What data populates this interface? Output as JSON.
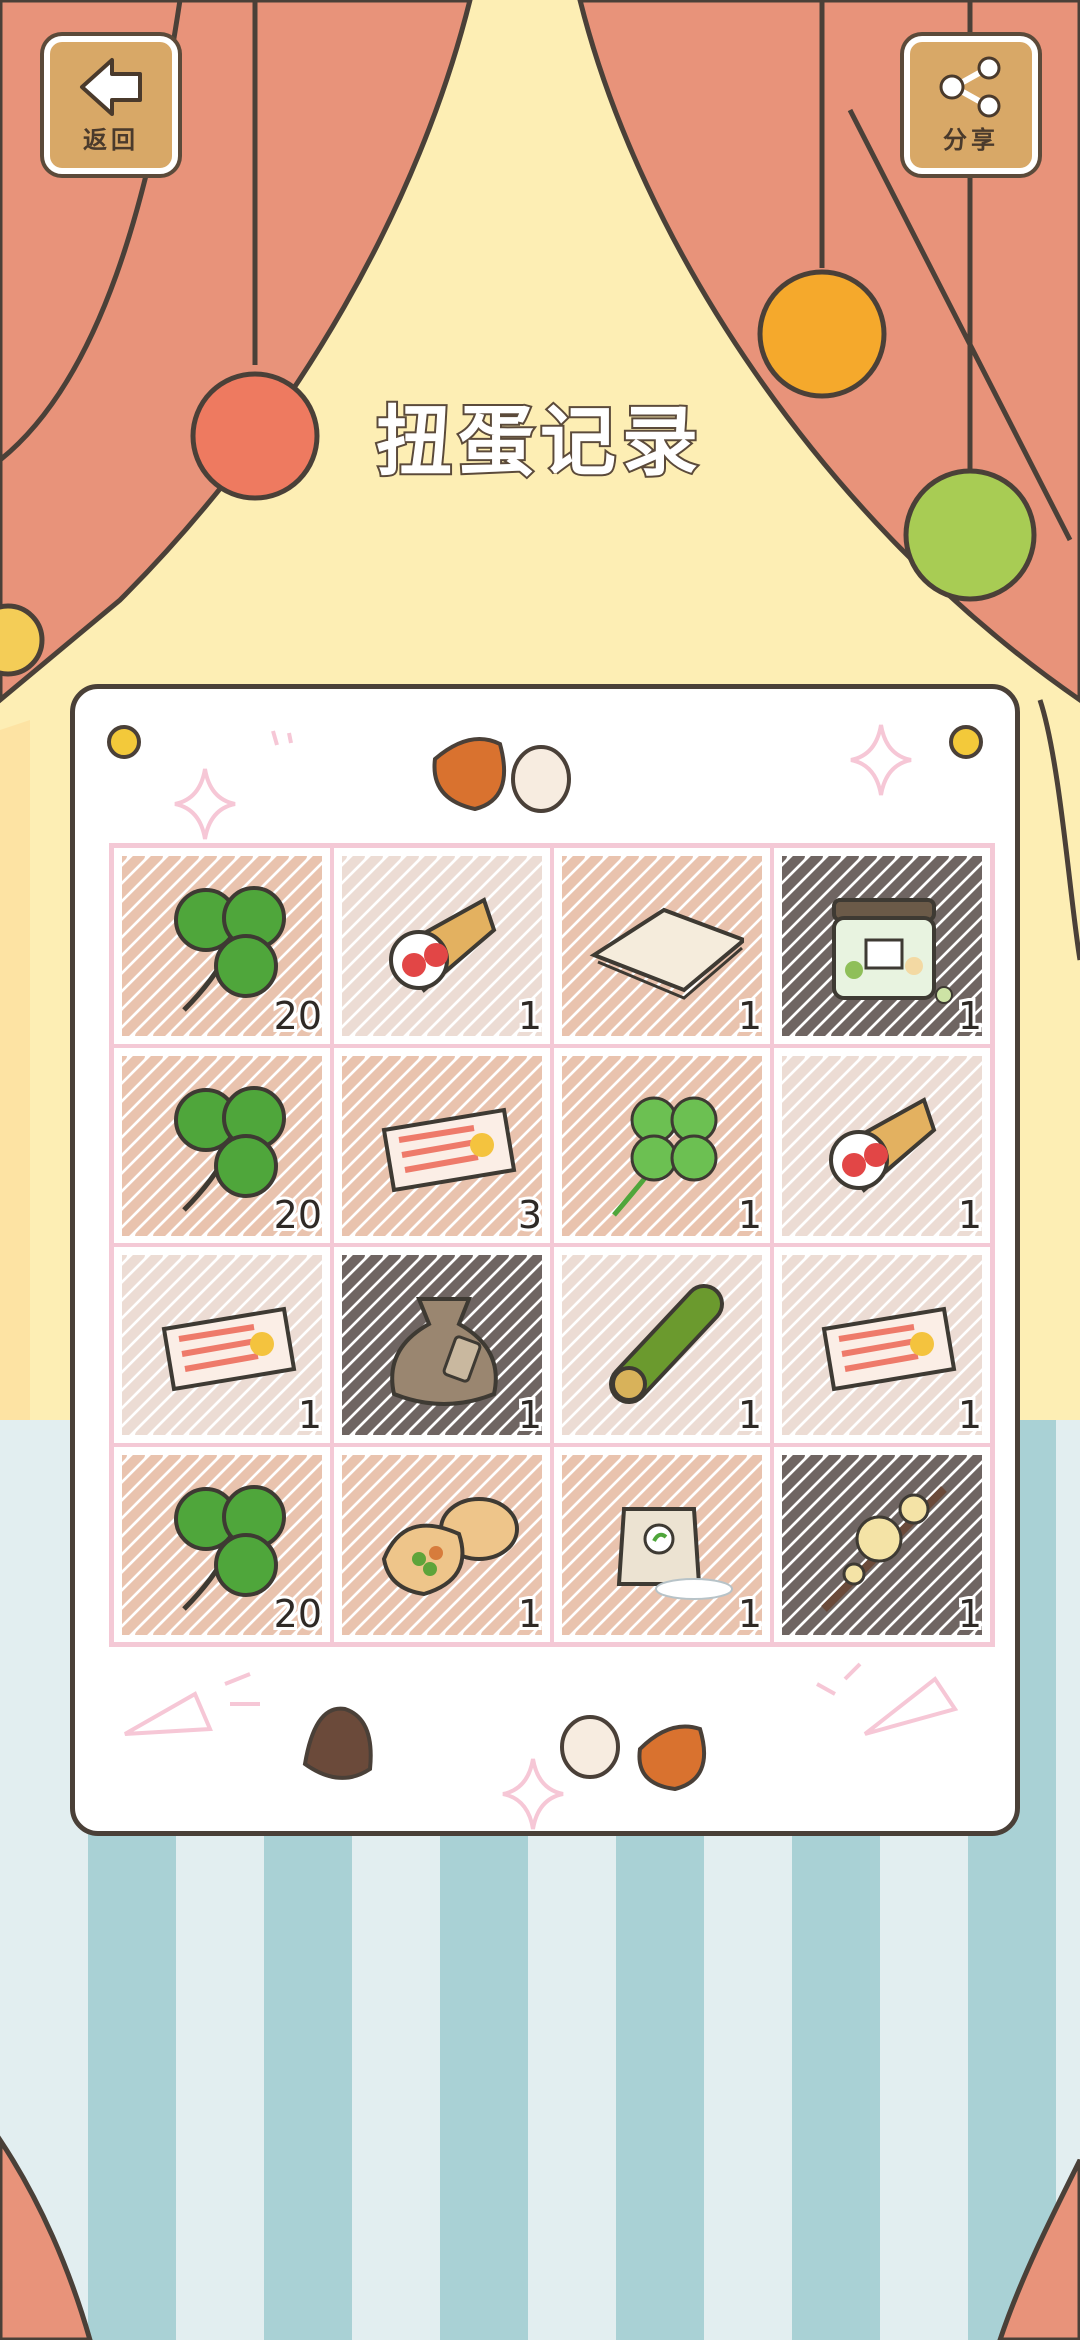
{
  "header": {
    "back_label": "返回",
    "share_label": "分享",
    "title": "扭蛋记录"
  },
  "records": [
    {
      "item": "clover",
      "count": "20"
    },
    {
      "item": "strawberry-crepe",
      "count": "1"
    },
    {
      "item": "paper-sheet",
      "count": "1"
    },
    {
      "item": "candy-jar",
      "count": "1"
    },
    {
      "item": "clover",
      "count": "20"
    },
    {
      "item": "ticket",
      "count": "3"
    },
    {
      "item": "four-leaf-clover",
      "count": "1"
    },
    {
      "item": "strawberry-crepe",
      "count": "1"
    },
    {
      "item": "ticket",
      "count": "1"
    },
    {
      "item": "cloth-sack",
      "count": "1"
    },
    {
      "item": "bamboo-tube",
      "count": "1"
    },
    {
      "item": "ticket",
      "count": "1"
    },
    {
      "item": "clover",
      "count": "20"
    },
    {
      "item": "stuffed-pita",
      "count": "1"
    },
    {
      "item": "flour-bag",
      "count": "1"
    },
    {
      "item": "plum-blossom-branch",
      "count": "1"
    }
  ],
  "hatch_colors": [
    "#e9c3ae",
    "#ecdcd4",
    "#e9c3ae",
    "#6f6562",
    "#e9c3ae",
    "#e9c3ae",
    "#e9c3ae",
    "#ecdcd4",
    "#ecdcd4",
    "#6f6562",
    "#ecdcd4",
    "#ecdcd4",
    "#e9c3ae",
    "#e9c3ae",
    "#e9c3ae",
    "#6f6562"
  ],
  "colors": {
    "curtain": "#e8937a",
    "outline": "#4a4038",
    "grid_border": "#f4c9d6"
  }
}
